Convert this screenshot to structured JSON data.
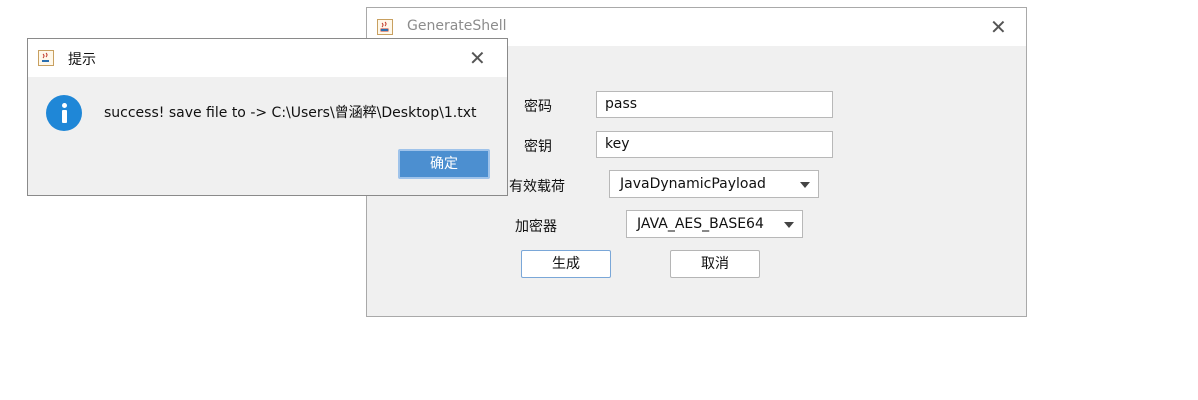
{
  "main_window": {
    "title": "GenerateShell",
    "fields": {
      "password_label": "密码",
      "password_value": "pass",
      "key_label": "密钥",
      "key_value": "key",
      "payload_label": "有效载荷",
      "payload_value": "JavaDynamicPayload",
      "encoder_label": "加密器",
      "encoder_value": "JAVA_AES_BASE64"
    },
    "buttons": {
      "generate": "生成",
      "cancel": "取消"
    },
    "close_glyph": "✕"
  },
  "alert_dialog": {
    "title": "提示",
    "message": "success! save file to -> C:\\Users\\曾涵粹\\Desktop\\1.txt",
    "ok_label": "确定",
    "close_glyph": "✕"
  },
  "icons": {
    "app_icon": "java-coffee-icon",
    "info_icon": "info-icon",
    "dropdown": "chevron-down-icon"
  },
  "colors": {
    "info_blue": "#1f87d7",
    "ok_button": "#4c8fd0",
    "window_bg": "#f0f0f0"
  }
}
